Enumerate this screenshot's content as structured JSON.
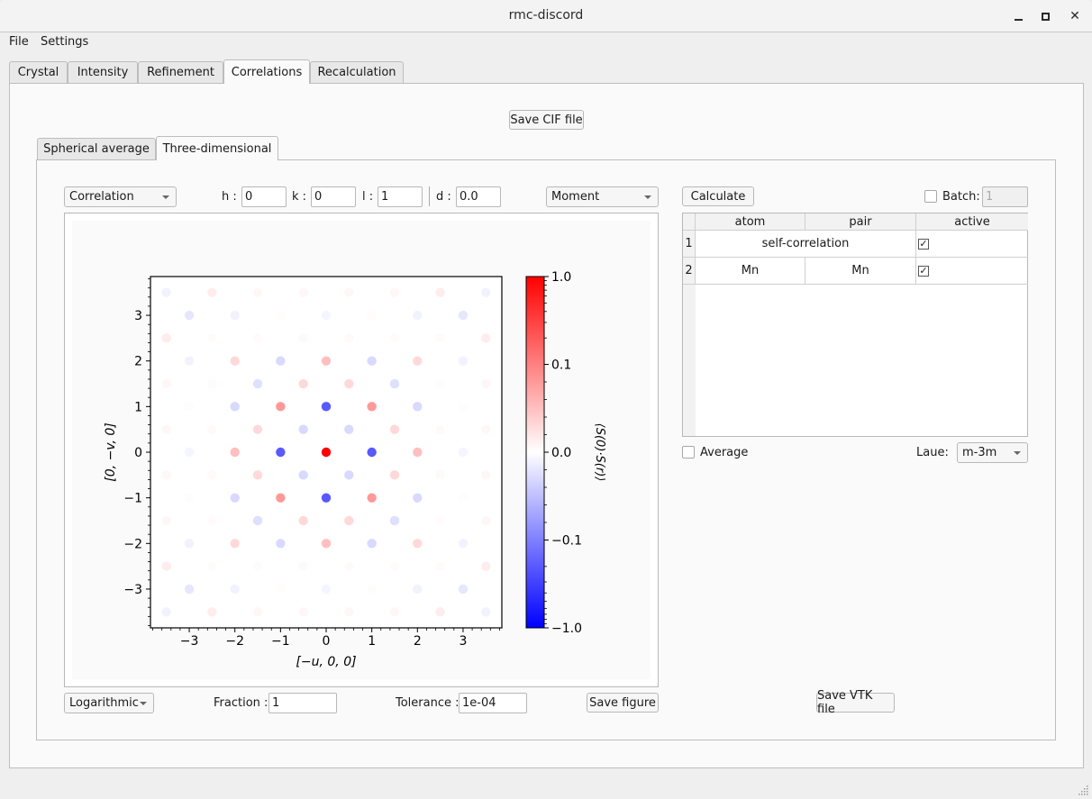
{
  "window": {
    "title": "rmc-discord"
  },
  "menu": [
    "File",
    "Settings"
  ],
  "main_tabs": [
    {
      "label": "Crystal"
    },
    {
      "label": "Intensity"
    },
    {
      "label": "Refinement"
    },
    {
      "label": "Correlations",
      "active": true
    },
    {
      "label": "Recalculation"
    }
  ],
  "save_cif_label": "Save CIF file",
  "sub_tabs": [
    {
      "label": "Spherical average"
    },
    {
      "label": "Three-dimensional",
      "active": true
    }
  ],
  "controls": {
    "type_combo": "Correlation",
    "h_label": "h :",
    "h_value": "0",
    "k_label": "k :",
    "k_value": "0",
    "l_label": "l :",
    "l_value": "1",
    "d_label": "d :",
    "d_value": "0.0",
    "quantity_combo": "Moment",
    "calculate_label": "Calculate",
    "batch_label": "Batch:",
    "batch_value": "1",
    "batch_checked": false,
    "scale_combo": "Logarithmic",
    "fraction_label": "Fraction :",
    "fraction_value": "1",
    "tolerance_label": "Tolerance :",
    "tolerance_value": "1e-04",
    "save_figure_label": "Save figure",
    "save_vtk_label": "Save VTK file",
    "average_label": "Average",
    "average_checked": false,
    "laue_label": "Laue:",
    "laue_value": "m-3m"
  },
  "table": {
    "headers": [
      "atom",
      "pair",
      "active"
    ],
    "rows": [
      {
        "index": "1",
        "atom": "self-correlation",
        "pair": "",
        "active": true,
        "span": true
      },
      {
        "index": "2",
        "atom": "Mn",
        "pair": "Mn",
        "active": true,
        "span": false
      }
    ]
  },
  "chart_data": {
    "type": "scatter",
    "xlabel": "[−u, 0, 0]",
    "ylabel": "[0, −v, 0]",
    "colorbar_label": "⟨S(0)·S(r)⟩",
    "xlim": [
      -3.85,
      3.85
    ],
    "ylim": [
      -3.85,
      3.85
    ],
    "xticks": [
      -3,
      -2,
      -1,
      0,
      1,
      2,
      3
    ],
    "yticks": [
      -3,
      -2,
      -1,
      0,
      1,
      2,
      3
    ],
    "colorbar_ticks": [
      "1.0",
      "0.1",
      "0.0",
      "−0.1",
      "−1.0"
    ],
    "colorbar_range": [
      -1.0,
      1.0
    ],
    "colormap": "bwr",
    "colors": {
      "positive": "#ff0000",
      "negative": "#0000ff",
      "zero": "#ffffff"
    },
    "note": "values symmetric under x→−x, y→−y, x↔y; keyed by sorted |x|,|y|",
    "values_by_abs": {
      "0,0": 1.0,
      "0,1": -0.2,
      "1,1": 0.08,
      "0,2": 0.05,
      "0.5,0.5": -0.03,
      "0.5,1.5": 0.03,
      "1,2": -0.03,
      "2,2": 0.03,
      "1.5,1.5": -0.025,
      "0.5,2.5": 0.004,
      "0,3": -0.008,
      "1,3": 0.002,
      "1.5,2.5": 0.003,
      "2,3": -0.01,
      "3,3": -0.02,
      "0.5,3.5": 0.006,
      "1.5,3.5": 0.006,
      "2.5,2.5": 0.003,
      "2.5,3.5": 0.015,
      "3.5,3.5": -0.01
    }
  }
}
